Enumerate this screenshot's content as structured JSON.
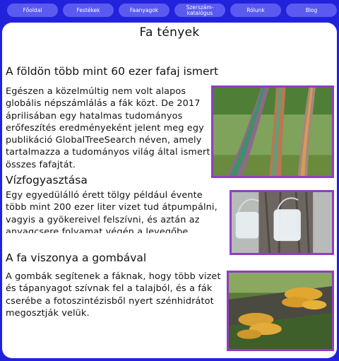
{
  "nav": {
    "items": [
      {
        "label": "Főoldal"
      },
      {
        "label": "Festékek"
      },
      {
        "label": "Faanyagok"
      },
      {
        "label": "Szerszám-\nkatalógus"
      },
      {
        "label": "Rólunk"
      },
      {
        "label": "Blog"
      }
    ]
  },
  "page": {
    "title": "Fa tények"
  },
  "sections": [
    {
      "heading": "A földön több mint 60 ezer fafaj ismert",
      "text": "Egészen a közelmúltig nem volt alapos globális népszámlálás a fák közt. De 2017 áprilisában egy hatalmas tudományos erőfeszítés eredményeként jelent meg egy publikáció GlobalTreeSearch néven, amely tartalmazza a tudományos világ által ismert összes fafajtát.",
      "image_icon": "rainbow-eucalyptus-trees-photo"
    },
    {
      "heading": "Vízfogyasztása",
      "text": "Egy egyedülálló érett tölgy például évente több mint 200 ezer liter vizet tud átpumpálni, vagyis a gyökereivel felszívni, és aztán az anyagcsere folyamat végén a levegőbe",
      "image_icon": "water-bags-on-tree-trunk-photo"
    },
    {
      "heading": "A fa viszonya a gombával",
      "text": "A gombák segítenek a fáknak, hogy több vizet és tápanyagot szívnak fel a talajból, és a fák cserébe a fotoszintézisből nyert szénhidrátot megosztják velük.",
      "image_icon": "bracket-fungus-on-log-photo"
    }
  ],
  "colors": {
    "background": "#2222dd",
    "nav_button": "#5a5af0",
    "image_border": "#8e3fc0",
    "panel": "#ffffff"
  }
}
